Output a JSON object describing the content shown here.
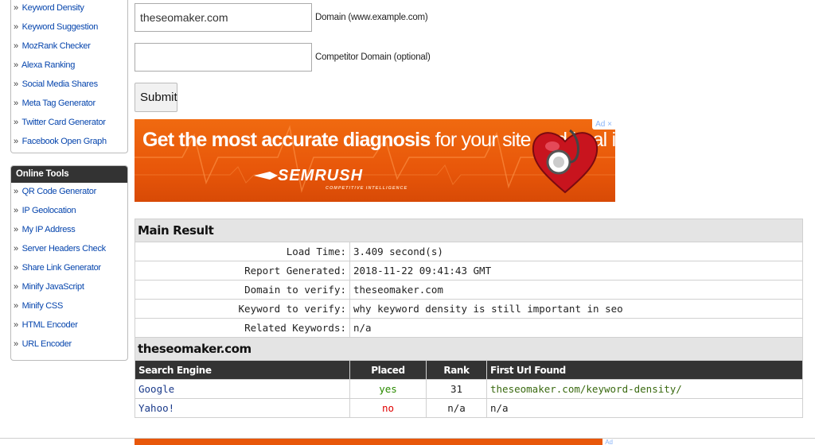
{
  "sidebar": {
    "seo_items": [
      "Keyword Density",
      "Keyword Suggestion",
      "MozRank Checker",
      "Alexa Ranking",
      "Social Media Shares",
      "Meta Tag Generator",
      "Twitter Card Generator",
      "Facebook Open Graph"
    ],
    "online_tools_title": "Online Tools",
    "online_tools": [
      "QR Code Generator",
      "IP Geolocation",
      "My IP Address",
      "Server Headers Check",
      "Share Link Generator",
      "Minify JavaScript",
      "Minify CSS",
      "HTML Encoder",
      "URL Encoder"
    ]
  },
  "form": {
    "domain_value": "theseomaker.com",
    "domain_hint": "Domain (www.example.com)",
    "competitor_value": "",
    "competitor_hint": "Competitor Domain (optional)",
    "submit_label": "Submit"
  },
  "ad": {
    "headline_bold": "Get the most accurate diagnosis",
    "headline_rest": " for your site and heal it!",
    "brand": "SEMRUSH",
    "brand_sub": "COMPETITIVE INTELLIGENCE",
    "ad_label": "Ad ×",
    "accent_color": "#e8570a"
  },
  "main_result": {
    "title": "Main Result",
    "rows": [
      {
        "label": "Load Time:",
        "value": "3.409 second(s)"
      },
      {
        "label": "Report Generated:",
        "value": "2018-11-22 09:41:43 GMT"
      },
      {
        "label": "Domain to verify:",
        "value": "theseomaker.com"
      },
      {
        "label": "Keyword to verify:",
        "value": "why keyword density is still important in seo"
      },
      {
        "label": "Related Keywords:",
        "value": "n/a"
      }
    ]
  },
  "domain_result": {
    "title": "theseomaker.com",
    "headers": [
      "Search Engine",
      "Placed",
      "Rank",
      "First Url Found"
    ],
    "rows": [
      {
        "engine": "Google",
        "placed": "yes",
        "rank": "31",
        "url": "theseomaker.com/keyword-density/"
      },
      {
        "engine": "Yahoo!",
        "placed": "no",
        "rank": "n/a",
        "url": "n/a"
      }
    ]
  },
  "ad2": {
    "label": "Ad"
  }
}
